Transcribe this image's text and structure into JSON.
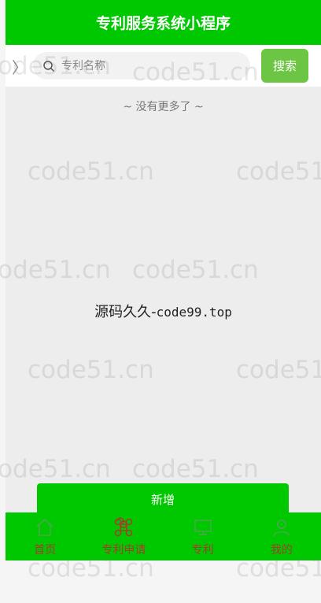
{
  "header": {
    "title": "专利服务系统小程序"
  },
  "search": {
    "placeholder": "专利名称",
    "button_label": "搜索"
  },
  "list": {
    "status_text": "~ 没有更多了 ~"
  },
  "center_overlay": {
    "text_cn": "源码久久-",
    "text_en": "code99.top"
  },
  "actions": {
    "add_label": "新增"
  },
  "tabbar": {
    "items": [
      {
        "label": "首页",
        "icon": "home-icon"
      },
      {
        "label": "专利申请",
        "icon": "command-icon"
      },
      {
        "label": "专利",
        "icon": "monitor-icon"
      },
      {
        "label": "我的",
        "icon": "user-icon"
      }
    ]
  },
  "watermark": {
    "text": "code51.cn"
  },
  "colors": {
    "primary": "#00c800",
    "search_button": "#6cc644",
    "tab_label": "#a23f2a"
  }
}
